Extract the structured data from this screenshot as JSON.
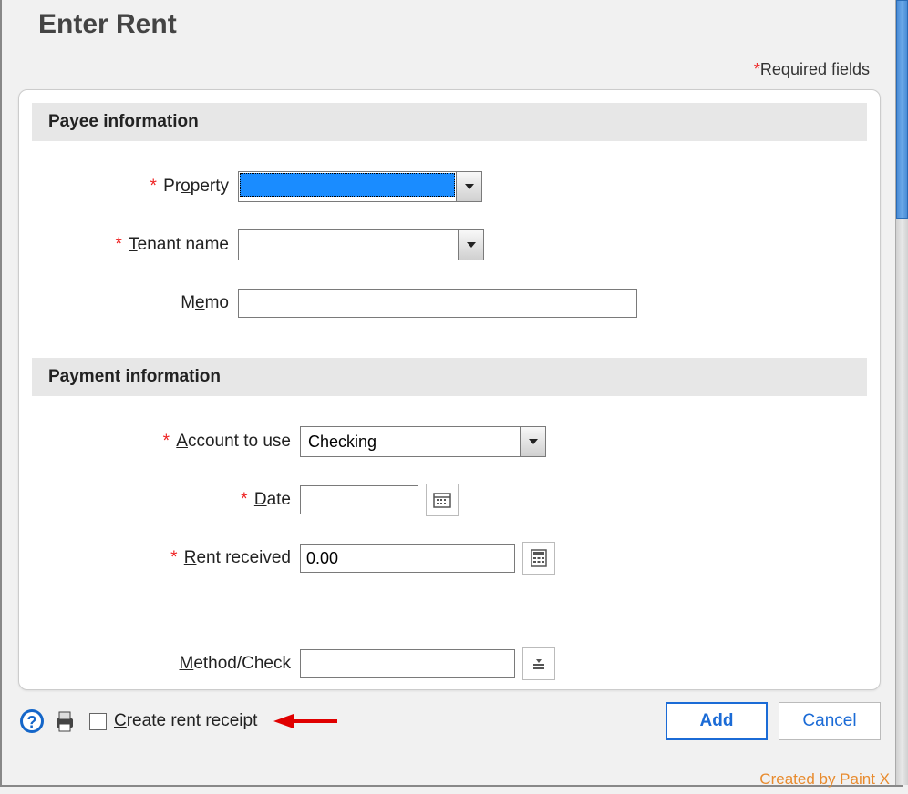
{
  "title": "Enter Rent",
  "required_note": "Required fields",
  "sections": {
    "payee": {
      "header": "Payee information",
      "property": {
        "label_pre": "Pr",
        "label_u": "o",
        "label_post": "perty",
        "value": ""
      },
      "tenant": {
        "label_pre": "",
        "label_u": "T",
        "label_post": "enant name",
        "value": ""
      },
      "memo": {
        "label_pre": "M",
        "label_u": "e",
        "label_post": "mo",
        "value": ""
      }
    },
    "payment": {
      "header": "Payment information",
      "account": {
        "label_pre": "",
        "label_u": "A",
        "label_post": "ccount to use",
        "value": "Checking"
      },
      "date": {
        "label_pre": "",
        "label_u": "D",
        "label_post": "ate",
        "value": ""
      },
      "rent": {
        "label_pre": "",
        "label_u": "R",
        "label_post": "ent received",
        "value": "0.00"
      },
      "method": {
        "label_pre": "",
        "label_u": "M",
        "label_post": "ethod/Check",
        "value": ""
      }
    }
  },
  "footer": {
    "receipt_pre": "",
    "receipt_u": "C",
    "receipt_post": "reate rent receipt",
    "add": "Add",
    "cancel": "Cancel"
  },
  "watermark": "Created by Paint X"
}
